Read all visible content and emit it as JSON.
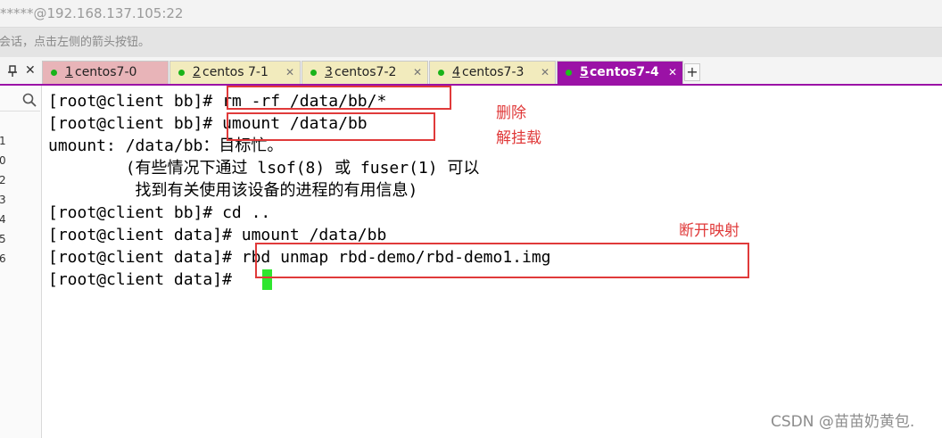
{
  "window": {
    "title": "*****@192.168.137.105:22",
    "hint": "会话，点击左侧的箭头按钮。"
  },
  "panel": {
    "pin_label": "ᵖ",
    "close_label": "✕",
    "row_numbers": [
      "1",
      "0",
      "2",
      "3",
      "4",
      "5",
      "6"
    ]
  },
  "tabs": [
    {
      "num": "1",
      "name": " centos7-0",
      "close": "✕",
      "bg": "#e8b4b8"
    },
    {
      "num": "2",
      "name": " centos 7-1",
      "close": "✕",
      "bg": "#f2ebbd"
    },
    {
      "num": "3",
      "name": " centos7-2",
      "close": "✕",
      "bg": "#f2ebbd"
    },
    {
      "num": "4",
      "name": " centos7-3",
      "close": "✕",
      "bg": "#f2ebbd"
    },
    {
      "num": "5",
      "name": " centos7-4",
      "close": "✕",
      "bg": "#9b12a6"
    }
  ],
  "add_tab": "+",
  "terminal": {
    "lines": [
      "[root@client bb]# rm -rf /data/bb/*",
      "[root@client bb]# umount /data/bb",
      "umount: /data/bb：目标忙。",
      "        (有些情况下通过 lsof(8) 或 fuser(1) 可以",
      "         找到有关使用该设备的进程的有用信息)",
      "[root@client bb]# cd ..",
      "[root@client data]# umount /data/bb",
      "[root@client data]# rbd unmap rbd-demo/rbd-demo1.img",
      "[root@client data]# "
    ]
  },
  "annotations": {
    "delete": "删除",
    "unmount": "解挂载",
    "unmap": "断开映射",
    "color": "#e03a3a"
  },
  "watermark": "CSDN @苗苗奶黄包."
}
